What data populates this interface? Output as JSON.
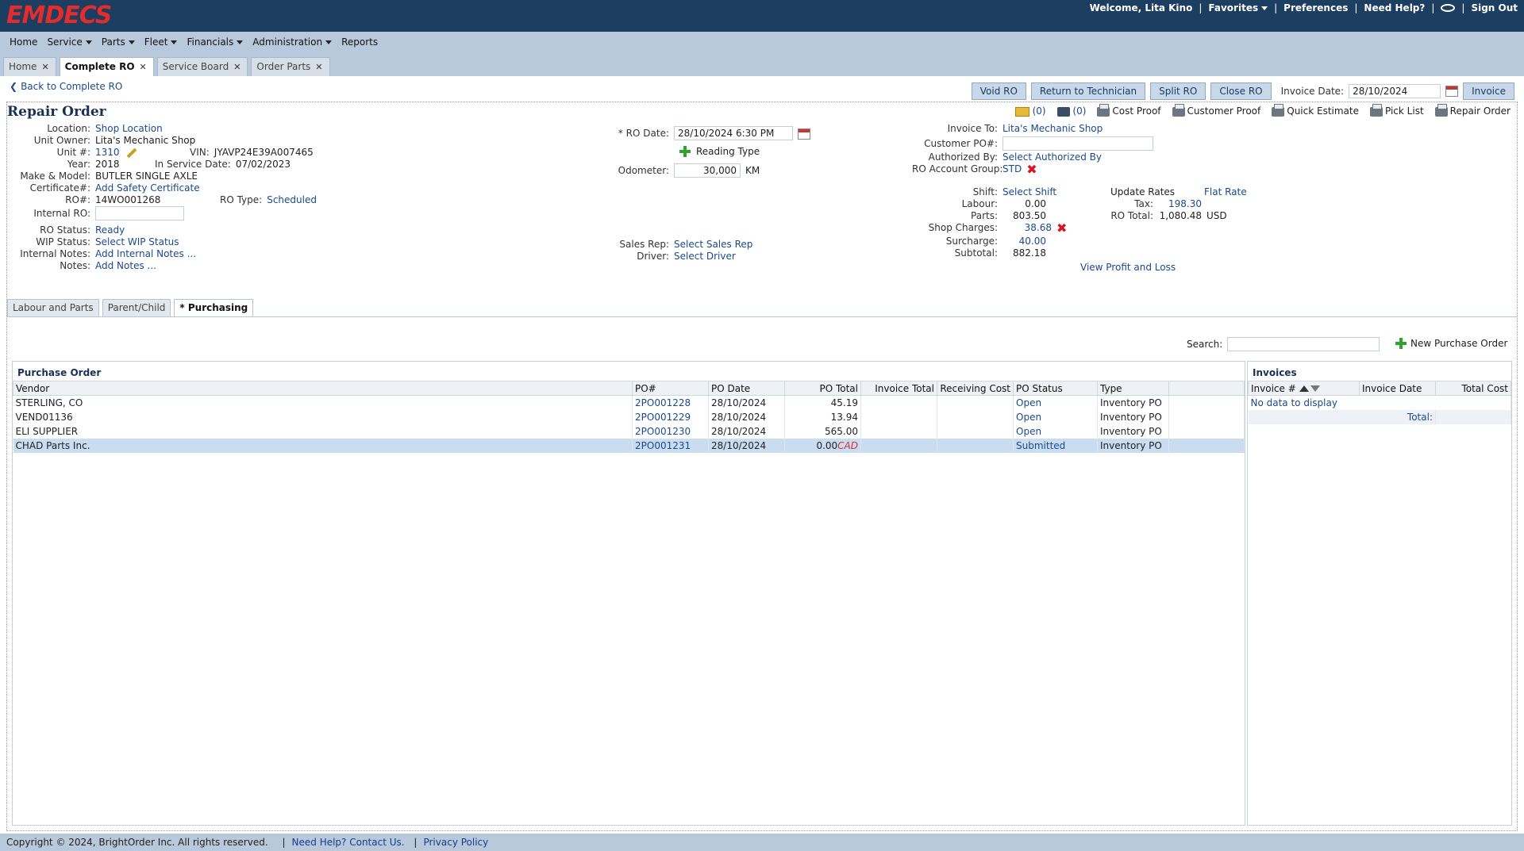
{
  "app": {
    "logo": "EMDECS"
  },
  "top": {
    "welcome": "Welcome, Lita Kino",
    "favorites": "Favorites",
    "preferences": "Preferences",
    "help": "Need Help?",
    "signout": "Sign Out"
  },
  "menu": [
    "Home",
    "Service",
    "Parts",
    "Fleet",
    "Financials",
    "Administration",
    "Reports"
  ],
  "tabs": [
    {
      "label": "Home"
    },
    {
      "label": "Complete RO"
    },
    {
      "label": "Service Board"
    },
    {
      "label": "Order Parts"
    }
  ],
  "back_link": "Back to Complete RO",
  "actions": {
    "void": "Void RO",
    "return": "Return to Technician",
    "split": "Split RO",
    "close": "Close RO",
    "invoice_date_label": "Invoice Date:",
    "invoice_date": "28/10/2024",
    "invoice": "Invoice"
  },
  "toolbar": {
    "email_count": "(0)",
    "photo_count": "(0)",
    "cost_proof": "Cost Proof",
    "customer_proof": "Customer Proof",
    "quick_estimate": "Quick Estimate",
    "pick_list": "Pick List",
    "repair_order": "Repair Order"
  },
  "ro": {
    "title": "Repair Order",
    "location_label": "Location:",
    "location": "Shop Location",
    "owner_label": "Unit Owner:",
    "owner": "Lita's Mechanic Shop",
    "unit_label": "Unit #:",
    "unit": "1310",
    "vin_label": "VIN:",
    "vin": "JYAVP24E39A007465",
    "year_label": "Year:",
    "year": "2018",
    "in_service_label": "In Service Date:",
    "in_service": "07/02/2023",
    "make_label": "Make & Model:",
    "make": "BUTLER SINGLE AXLE",
    "cert_label": "Certificate#:",
    "cert": "Add Safety Certificate",
    "ro_num_label": "RO#:",
    "ro_num": "14WO001268",
    "ro_type_label": "RO Type:",
    "ro_type": "Scheduled",
    "internal_ro_label": "Internal RO:",
    "status_label": "RO Status:",
    "status": "Ready",
    "wip_label": "WIP Status:",
    "wip": "Select WIP Status",
    "internal_notes_label": "Internal Notes:",
    "internal_notes": "Add Internal Notes ...",
    "notes_label": "Notes:",
    "notes": "Add Notes ...",
    "ro_date_label": "* RO Date:",
    "ro_date": "28/10/2024 6:30 PM",
    "reading_type": "Reading Type",
    "odometer_label": "Odometer:",
    "odometer": "30,000",
    "odometer_unit": "KM",
    "sales_rep_label": "Sales Rep:",
    "sales_rep": "Select Sales Rep",
    "driver_label": "Driver:",
    "driver": "Select Driver",
    "invoice_to_label": "Invoice To:",
    "invoice_to": "Lita's Mechanic Shop",
    "customer_po_label": "Customer PO#:",
    "authorized_label": "Authorized By:",
    "authorized": "Select Authorized By",
    "account_group_label": "RO Account Group:",
    "account_group": "STD",
    "shift_label": "Shift:",
    "shift": "Select Shift",
    "update_rates": "Update Rates",
    "flat_rate": "Flat Rate",
    "labour_label": "Labour:",
    "labour": "0.00",
    "parts_label": "Parts:",
    "parts": "803.50",
    "shop_charges_label": "Shop Charges:",
    "shop_charges": "38.68",
    "surcharge_label": "Surcharge:",
    "surcharge": "40.00",
    "subtotal_label": "Subtotal:",
    "subtotal": "882.18",
    "tax_label": "Tax:",
    "tax": "198.30",
    "ro_total_label": "RO Total:",
    "ro_total": "1,080.48",
    "currency": "USD",
    "profit_loss": "View Profit and Loss"
  },
  "subtabs": [
    {
      "label": "Labour and Parts"
    },
    {
      "label": "Parent/Child"
    },
    {
      "label": "* Purchasing"
    }
  ],
  "search_label": "Search:",
  "new_po": "New Purchase Order",
  "po": {
    "title": "Purchase Order",
    "headers": [
      "Vendor",
      "PO#",
      "PO Date",
      "PO Total",
      "Invoice Total",
      "Receiving Cost",
      "PO Status",
      "Type"
    ],
    "rows": [
      {
        "vendor": "STERLING, CO",
        "po": "2PO001228",
        "date": "28/10/2024",
        "total": "45.19",
        "cur": "",
        "status": "Open",
        "type": "Inventory PO"
      },
      {
        "vendor": "VEND01136",
        "po": "2PO001229",
        "date": "28/10/2024",
        "total": "13.94",
        "cur": "",
        "status": "Open",
        "type": "Inventory PO"
      },
      {
        "vendor": "ELI SUPPLIER",
        "po": "2PO001230",
        "date": "28/10/2024",
        "total": "565.00",
        "cur": "",
        "status": "Open",
        "type": "Inventory PO"
      },
      {
        "vendor": "CHAD Parts Inc.",
        "po": "2PO001231",
        "date": "28/10/2024",
        "total": "0.00",
        "cur": "CAD",
        "status": "Submitted",
        "type": "Inventory PO"
      }
    ]
  },
  "invoices": {
    "title": "Invoices",
    "headers": [
      "Invoice #",
      "Invoice Date",
      "Total Cost"
    ],
    "empty": "No data to display",
    "total_label": "Total:"
  },
  "footer": {
    "copyright": "Copyright © 2024, BrightOrder Inc. All rights reserved.",
    "help": "Need Help? Contact Us.",
    "privacy": "Privacy Policy"
  }
}
